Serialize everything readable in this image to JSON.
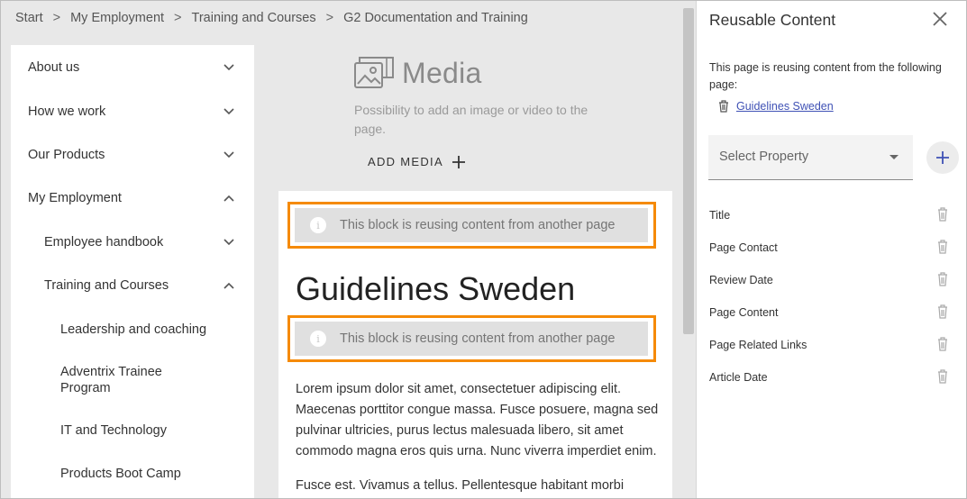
{
  "breadcrumb": {
    "items": [
      "Start",
      "My Employment",
      "Training and Courses",
      "G2 Documentation and Training"
    ],
    "separator": ">"
  },
  "sidebar": {
    "items": [
      {
        "label": "About us",
        "expanded": false
      },
      {
        "label": "How we work",
        "expanded": false
      },
      {
        "label": "Our Products",
        "expanded": false
      },
      {
        "label": "My Employment",
        "expanded": true
      },
      {
        "label": "Employee handbook",
        "expanded": false
      },
      {
        "label": "Training and Courses",
        "expanded": true
      },
      {
        "label": "Leadership and coaching"
      },
      {
        "label": "Adventrix Trainee Program"
      },
      {
        "label": "IT and Technology"
      },
      {
        "label": "Products Boot Camp"
      }
    ]
  },
  "media": {
    "title": "Media",
    "description": "Possibility to add an image or video to the page.",
    "add_label": "ADD MEDIA",
    "icon": "image-gallery-icon"
  },
  "content": {
    "reuse_notice": "This block is reusing content from another page",
    "heading": "Guidelines Sweden",
    "paragraph1": "Lorem ipsum dolor sit amet, consectetuer adipiscing elit. Maecenas porttitor congue massa. Fusce posuere, magna sed pulvinar ultricies, purus lectus malesuada libero, sit amet commodo magna eros quis urna. Nunc viverra imperdiet enim.",
    "paragraph2": "Fusce est. Vivamus a tellus. Pellentesque habitant morbi",
    "highlight_color": "#f58a07"
  },
  "panel": {
    "title": "Reusable Content",
    "description": "This page is reusing content from the following page:",
    "source_page": "Guidelines Sweden",
    "select_placeholder": "Select Property",
    "properties": [
      "Title",
      "Page Contact",
      "Review Date",
      "Page Content",
      "Page Related Links",
      "Article Date"
    ],
    "link_color": "#3f51b5"
  }
}
